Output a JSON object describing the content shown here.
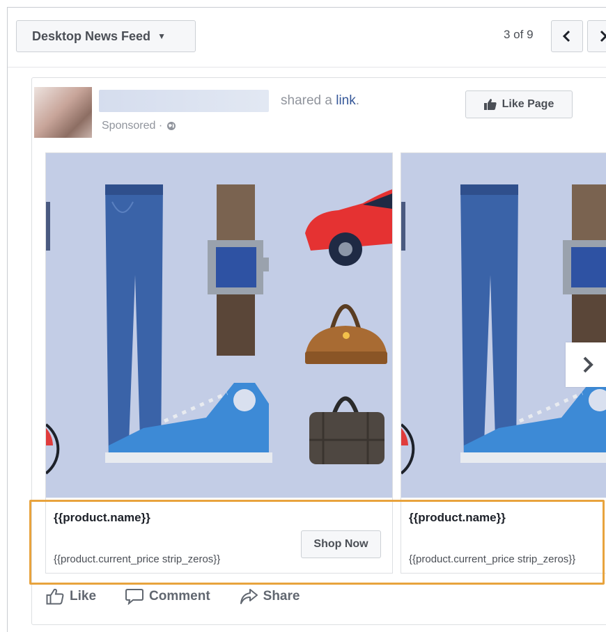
{
  "toolbar": {
    "placement_label": "Desktop News Feed",
    "pager_text": "3 of 9"
  },
  "post": {
    "shared_text": "shared a ",
    "link_text": "link",
    "link_suffix": ".",
    "sponsored_text": "Sponsored · ",
    "like_page_label": "Like Page"
  },
  "cards": [
    {
      "name": "{{product.name}}",
      "price": "{{product.current_price strip_zeros}}",
      "cta": "Shop Now"
    },
    {
      "name": "{{product.name}}",
      "price": "{{product.current_price strip_zeros}}"
    }
  ],
  "actions": {
    "like": "Like",
    "comment": "Comment",
    "share": "Share"
  },
  "colors": {
    "link": "#365899",
    "highlight": "#e8a33d",
    "image_background": "#c3cde6"
  }
}
